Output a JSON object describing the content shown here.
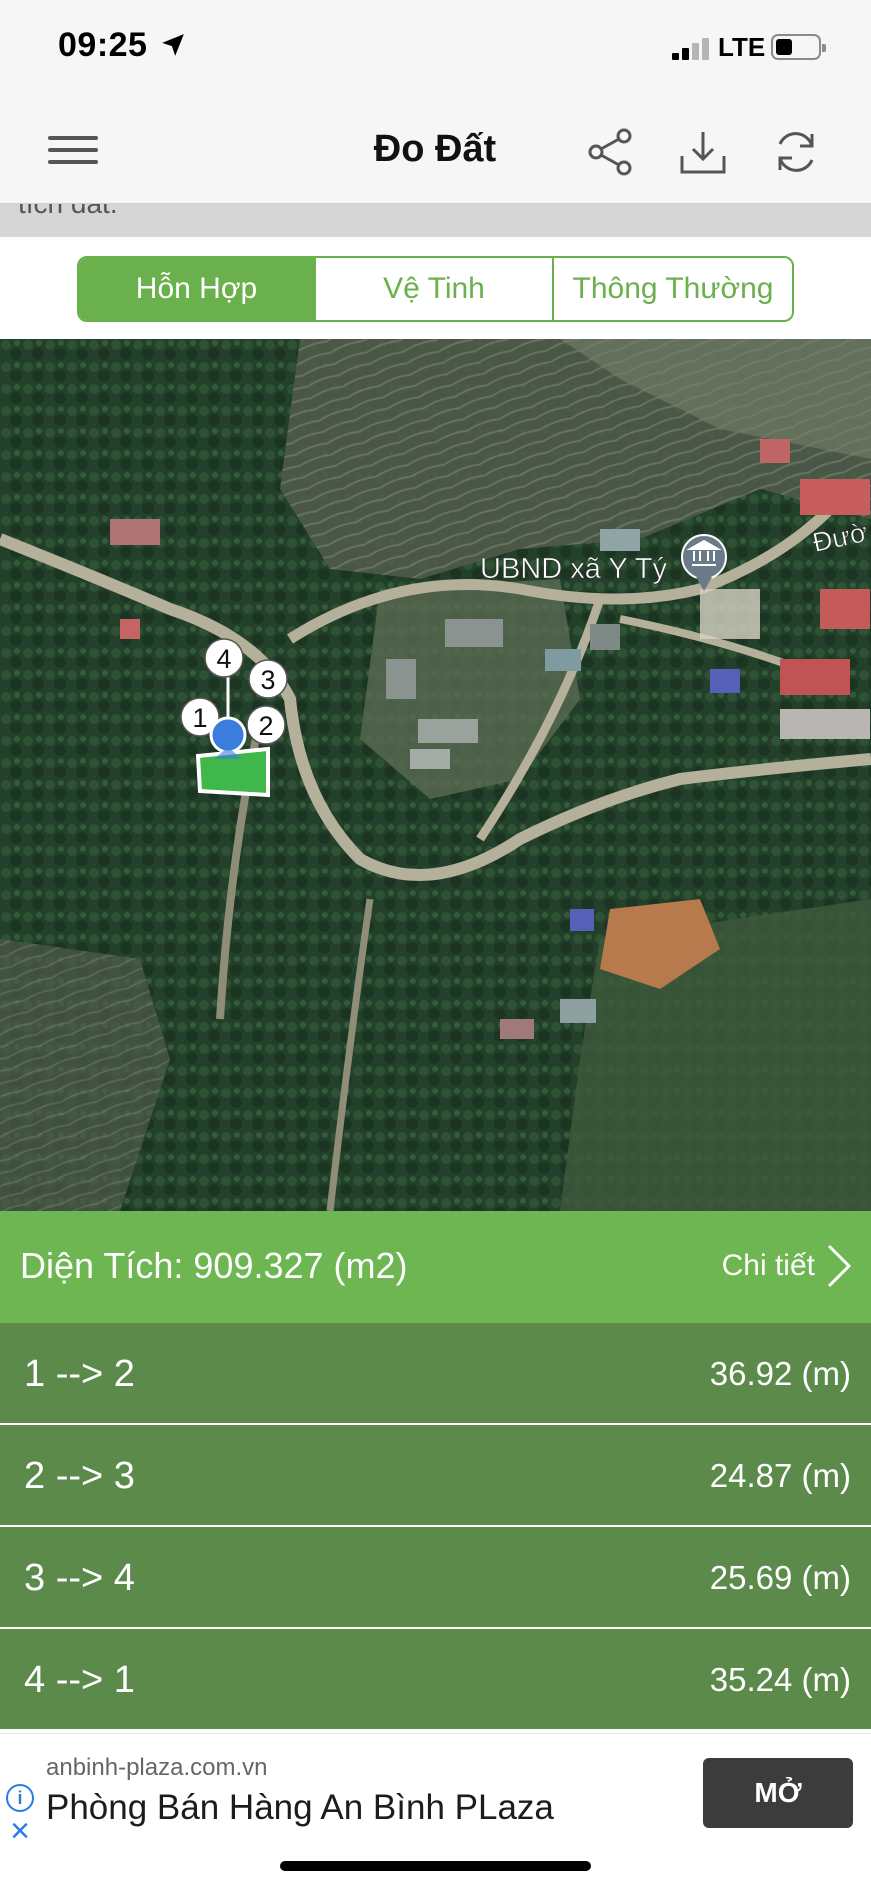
{
  "status_bar": {
    "time": "09:25",
    "network": "LTE",
    "battery_level": 0.3
  },
  "nav": {
    "title": "Đo Đất"
  },
  "partial_text": "tích đất.",
  "map_type": {
    "selected": "Hỗn Hợp",
    "options": [
      "Hỗn Hợp",
      "Vệ Tinh",
      "Thông Thường"
    ]
  },
  "map": {
    "poi_label": "UBND xã Y Tý",
    "road_label": "Đườ",
    "markers": [
      "1",
      "2",
      "3",
      "4"
    ]
  },
  "area": {
    "label": "Diện Tích: 909.327 (m2)",
    "detail_label": "Chi tiết"
  },
  "distances": [
    {
      "segment": "1 --> 2",
      "length": "36.92 (m)"
    },
    {
      "segment": "2 --> 3",
      "length": "24.87 (m)"
    },
    {
      "segment": "3 --> 4",
      "length": "25.69 (m)"
    },
    {
      "segment": "4 --> 1",
      "length": "35.24 (m)"
    }
  ],
  "ad": {
    "domain": "anbinh-plaza.com.vn",
    "title": "Phòng Bán Hàng An Bình PLaza",
    "button_label": "MỞ"
  },
  "colors": {
    "accent_green": "#6ab04c",
    "area_bar": "#6db652",
    "distance_rows": "#5b8a4a",
    "marker_blue": "#3b7ddd"
  }
}
